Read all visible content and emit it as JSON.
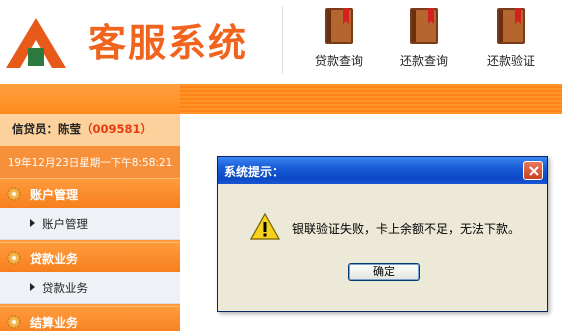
{
  "header": {
    "title": "客服系统",
    "nav": [
      {
        "label": "贷款查询",
        "icon": "book-icon"
      },
      {
        "label": "还款查询",
        "icon": "book-icon"
      },
      {
        "label": "还款验证",
        "icon": "book-icon"
      }
    ]
  },
  "sidebar": {
    "user_label": "信贷员：陈莹",
    "user_id": "（009581）",
    "datetime": "19年12月23日星期一下午8:58:21",
    "groups": [
      {
        "label": "账户管理",
        "sub": "账户管理"
      },
      {
        "label": "贷款业务",
        "sub": "贷款业务"
      },
      {
        "label": "结算业务"
      }
    ]
  },
  "dialog": {
    "title": "系统提示：",
    "message": "银联验证失败，卡上余额不足，无法下款。",
    "ok_label": "确定",
    "icon": "warning-icon"
  },
  "colors": {
    "brand": "#f0641e",
    "sidebar": "#ff9a3c",
    "dialog_title": "#0a48c4"
  }
}
